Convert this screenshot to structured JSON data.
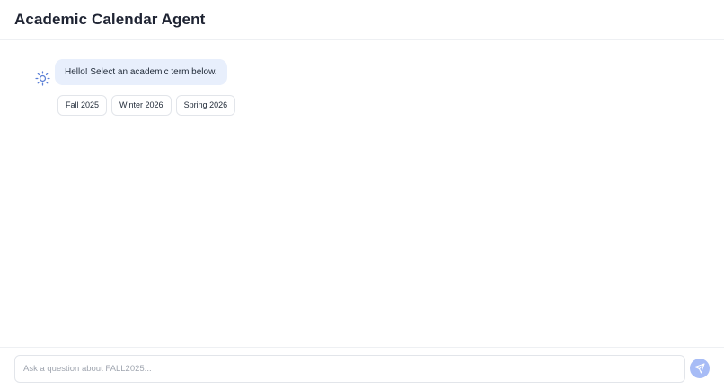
{
  "header": {
    "title": "Academic Calendar Agent"
  },
  "chat": {
    "bot_icon": "sun-icon",
    "bot_message": "Hello! Select an academic term below.",
    "options": [
      "Fall 2025",
      "Winter 2026",
      "Spring 2026"
    ]
  },
  "composer": {
    "placeholder": "Ask a question about FALL2025...",
    "value": "",
    "send_icon": "send-icon"
  },
  "colors": {
    "bubble_bg": "#e8effc",
    "send_button": "#a7bcf6",
    "icon_accent": "#5b7fd6"
  }
}
